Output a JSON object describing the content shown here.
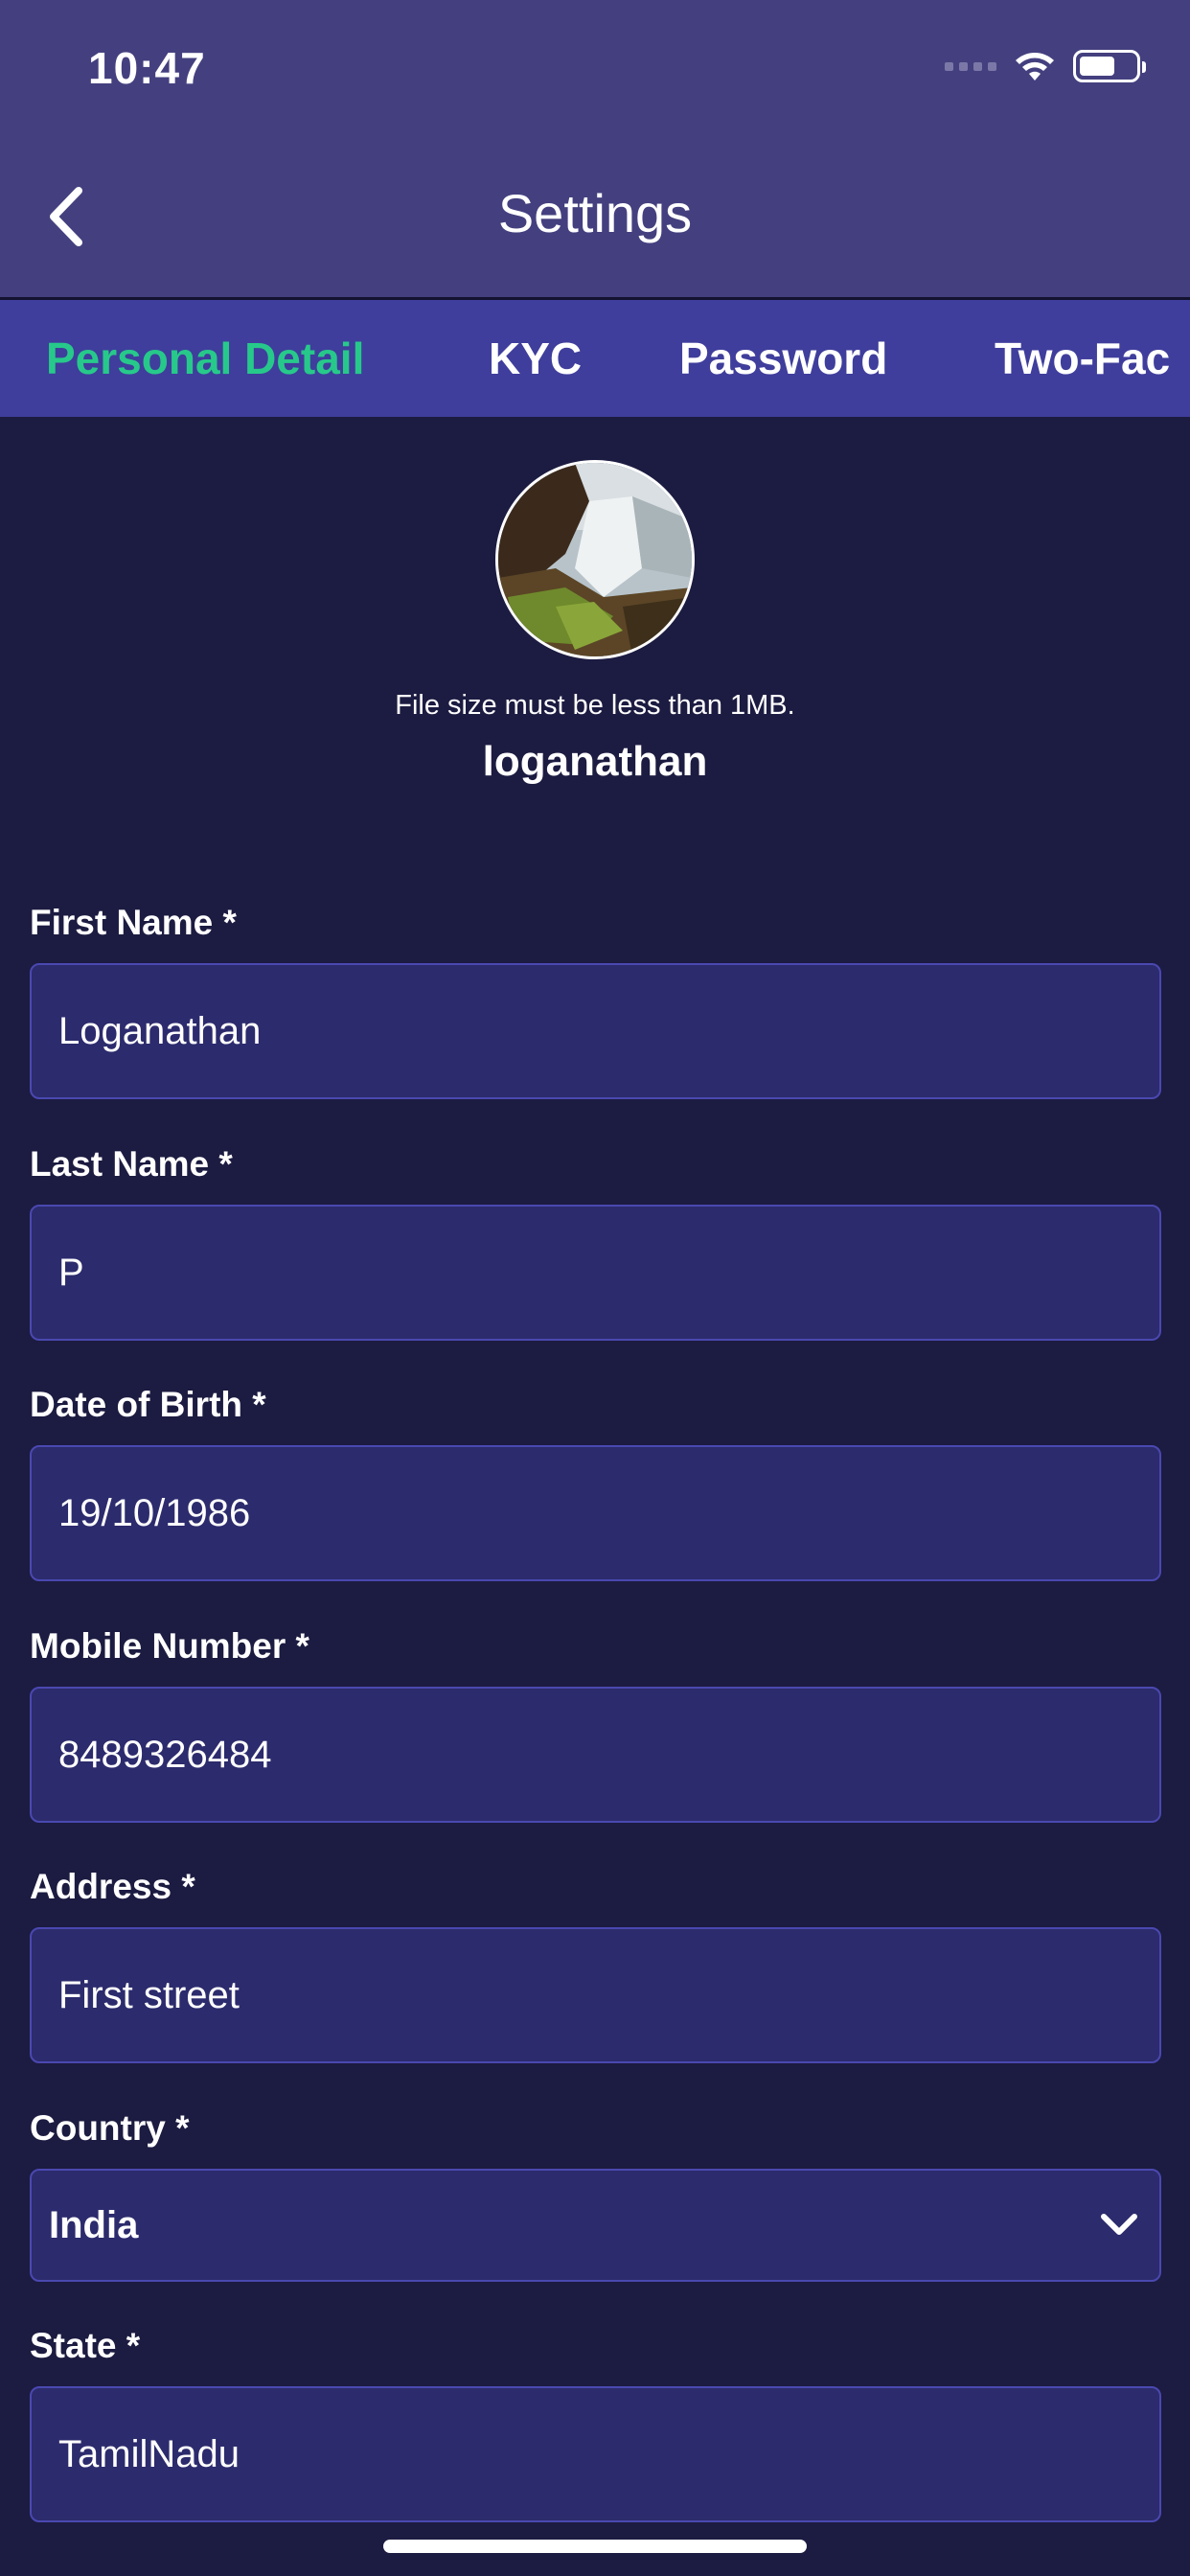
{
  "status_bar": {
    "time": "10:47"
  },
  "header": {
    "title": "Settings"
  },
  "tabs": [
    {
      "label": "Personal Detail",
      "active": true
    },
    {
      "label": "KYC",
      "active": false
    },
    {
      "label": "Password",
      "active": false
    },
    {
      "label": "Two-Fac",
      "active": false
    }
  ],
  "profile": {
    "file_note": "File size must be less than 1MB.",
    "username": "loganathan"
  },
  "form": {
    "first_name": {
      "label": "First Name *",
      "value": "Loganathan"
    },
    "last_name": {
      "label": "Last Name *",
      "value": "P"
    },
    "dob": {
      "label": "Date of Birth *",
      "value": "19/10/1986"
    },
    "mobile": {
      "label": "Mobile Number *",
      "value": "8489326484"
    },
    "address": {
      "label": "Address *",
      "value": "First street"
    },
    "country": {
      "label": "Country *",
      "value": "India"
    },
    "state": {
      "label": "State *",
      "value": "TamilNadu"
    }
  },
  "colors": {
    "background": "#1c1b41",
    "header": "#44407f",
    "tab_bar": "#3f3e9c",
    "tab_active": "#27c98a",
    "field_bg": "#2c2b6d",
    "field_border": "#4a48b0"
  },
  "icons": [
    "back-chevron-icon",
    "signal-icon",
    "wifi-icon",
    "battery-icon",
    "chevron-down-icon"
  ]
}
